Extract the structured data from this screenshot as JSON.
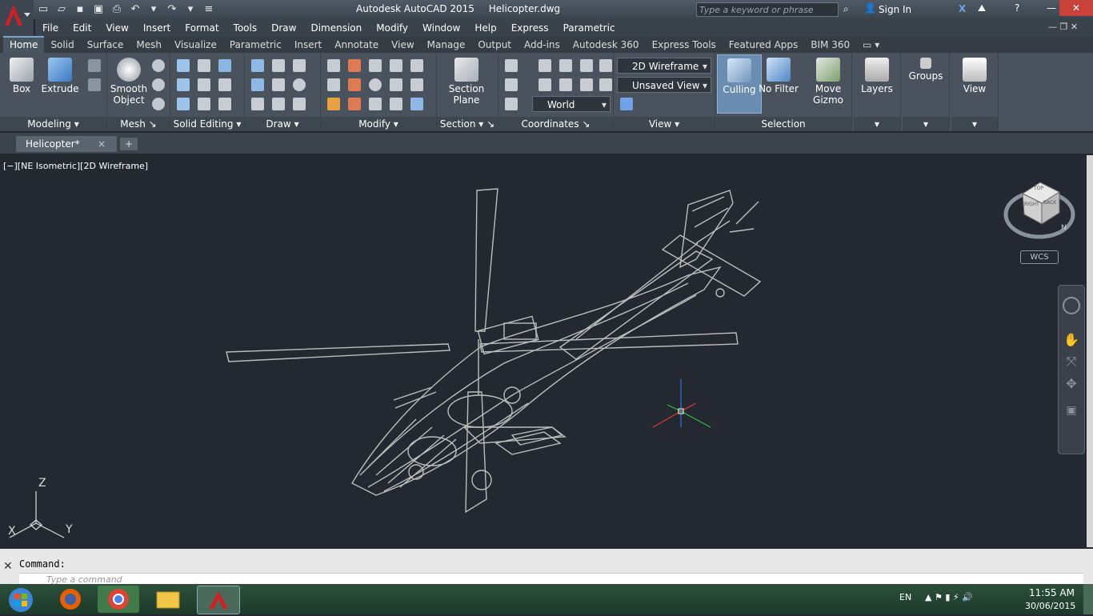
{
  "app": {
    "name": "Autodesk AutoCAD 2015",
    "file": "Helicopter.dwg"
  },
  "search": {
    "placeholder": "Type a keyword or phrase"
  },
  "account": {
    "signin": "Sign In"
  },
  "menubar": [
    "File",
    "Edit",
    "View",
    "Insert",
    "Format",
    "Tools",
    "Draw",
    "Dimension",
    "Modify",
    "Window",
    "Help",
    "Express",
    "Parametric"
  ],
  "ribbon_tabs": [
    "Home",
    "Solid",
    "Surface",
    "Mesh",
    "Visualize",
    "Parametric",
    "Insert",
    "Annotate",
    "View",
    "Manage",
    "Output",
    "Add-ins",
    "Autodesk 360",
    "Express Tools",
    "Featured Apps",
    "BIM 360"
  ],
  "panels": {
    "modeling": {
      "title": "Modeling",
      "box": "Box",
      "extrude": "Extrude"
    },
    "mesh": {
      "title": "Mesh",
      "smooth": "Smooth",
      "object": "Object"
    },
    "solid_editing": {
      "title": "Solid Editing"
    },
    "draw": {
      "title": "Draw"
    },
    "modify": {
      "title": "Modify"
    },
    "section": {
      "title": "Section",
      "plane1": "Section",
      "plane2": "Plane"
    },
    "coordinates": {
      "title": "Coordinates",
      "world": "World"
    },
    "view": {
      "title": "View",
      "visual_style": "2D Wireframe",
      "saved_view": "Unsaved View"
    },
    "selection": {
      "title": "Selection",
      "culling": "Culling",
      "no_filter": "No Filter",
      "move": "Move",
      "gizmo": "Gizmo"
    },
    "layers": {
      "label": "Layers"
    },
    "groups": {
      "label": "Groups"
    },
    "view_big": {
      "label": "View"
    }
  },
  "file_tab": {
    "name": "Helicopter*",
    "close": "×",
    "new": "+"
  },
  "viewport": {
    "label": "[−][NE Isometric][2D Wireframe]",
    "wcs": "WCS"
  },
  "viewcube": {
    "top": "TOP",
    "right": "RIGHT",
    "back": "BACK",
    "n": "N"
  },
  "ucs": {
    "z": "Z",
    "x": "X",
    "y": "Y"
  },
  "command": {
    "label": "Command:",
    "placeholder": "Type a command"
  },
  "tray": {
    "lang": "EN",
    "time": "11:55 AM",
    "date": "30/06/2015"
  },
  "colors": {
    "accent": "#7aa7d0",
    "wire": "#bdbdbd",
    "viewport_bg": "#232831"
  }
}
